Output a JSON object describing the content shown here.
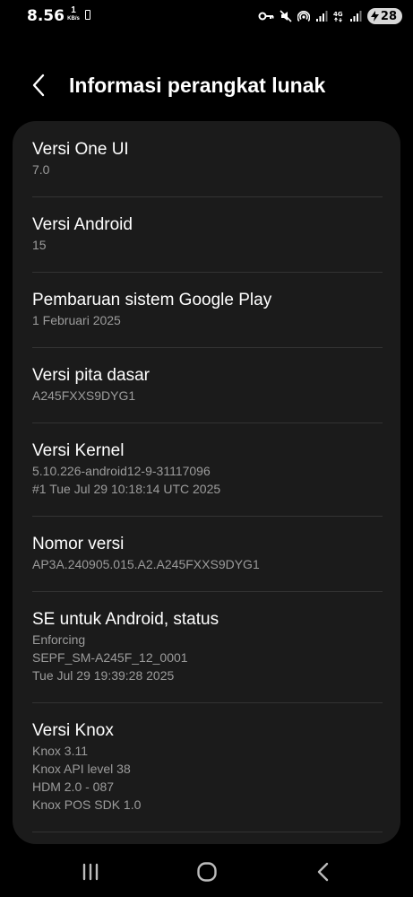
{
  "status_bar": {
    "time": "8.56",
    "net_speed_value": "1",
    "net_speed_unit": "KB/s",
    "battery_level": "28",
    "icons": [
      "battery-saver-icon",
      "vpn-key-icon",
      "mute-icon",
      "hotspot-icon",
      "signal-icon",
      "4g-icon",
      "signal-icon",
      "charging-icon"
    ]
  },
  "header": {
    "title": "Informasi perangkat lunak"
  },
  "items": [
    {
      "title": "Versi One UI",
      "lines": [
        "7.0"
      ]
    },
    {
      "title": "Versi Android",
      "lines": [
        "15"
      ]
    },
    {
      "title": "Pembaruan sistem Google Play",
      "lines": [
        "1 Februari 2025"
      ]
    },
    {
      "title": "Versi pita dasar",
      "lines": [
        "A245FXXS9DYG1"
      ]
    },
    {
      "title": "Versi Kernel",
      "lines": [
        "5.10.226-android12-9-31117096",
        "#1 Tue Jul 29 10:18:14 UTC 2025"
      ]
    },
    {
      "title": "Nomor versi",
      "lines": [
        "AP3A.240905.015.A2.A245FXXS9DYG1"
      ]
    },
    {
      "title": "SE untuk Android, status",
      "lines": [
        "Enforcing",
        "SEPF_SM-A245F_12_0001",
        "Tue Jul 29 19:39:28 2025"
      ]
    },
    {
      "title": "Versi Knox",
      "lines": [
        "Knox 3.11",
        "Knox API level 38",
        "HDM 2.0 - 087",
        "Knox POS SDK 1.0"
      ]
    }
  ],
  "colors": {
    "background": "#000000",
    "card": "#1b1b1b",
    "primary_text": "#ffffff",
    "secondary_text": "#9c9c9c",
    "divider": "#333333"
  }
}
